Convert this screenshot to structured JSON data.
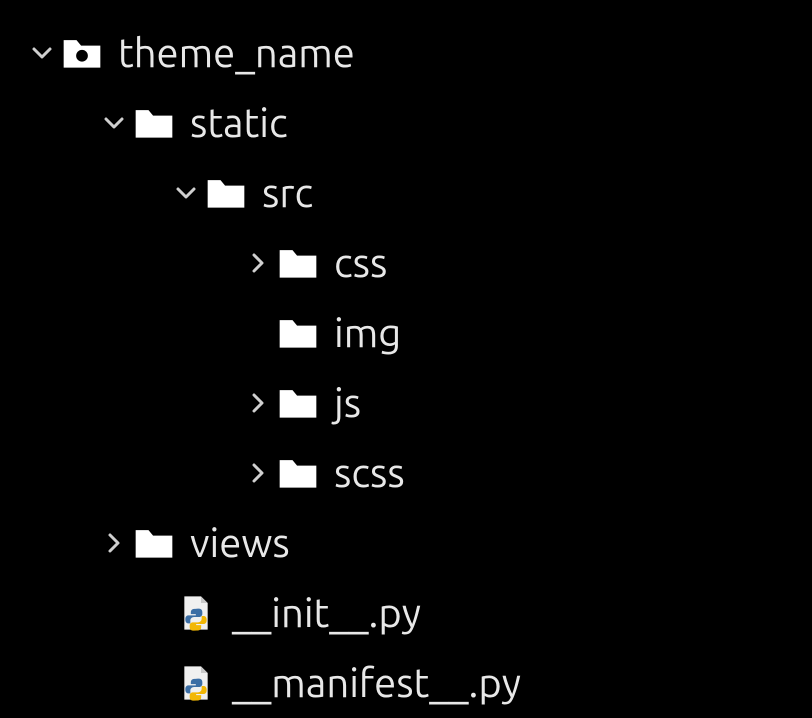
{
  "tree": {
    "root": {
      "label": "theme_name",
      "expanded": true
    },
    "static": {
      "label": "static",
      "expanded": true
    },
    "src": {
      "label": "src",
      "expanded": true
    },
    "css": {
      "label": "css",
      "expanded": false
    },
    "img": {
      "label": "img"
    },
    "js": {
      "label": "js",
      "expanded": false
    },
    "scss": {
      "label": "scss",
      "expanded": false
    },
    "views": {
      "label": "views",
      "expanded": false
    },
    "init_py": {
      "label": "__init__.py"
    },
    "manifest_py": {
      "label": "__manifest__.py"
    }
  }
}
